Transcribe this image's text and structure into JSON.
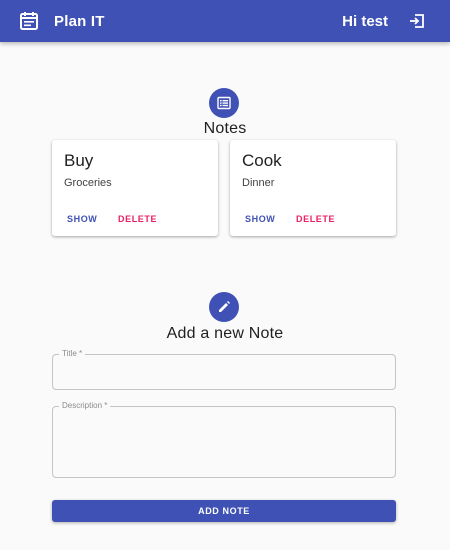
{
  "appbar": {
    "title": "Plan IT",
    "greeting": "Hi test",
    "app_icon": "event-note-icon",
    "logout_icon": "logout-icon"
  },
  "notes_section": {
    "title": "Notes",
    "icon": "list-alt-icon",
    "cards": [
      {
        "title": "Buy",
        "subtitle": "Groceries",
        "show_label": "SHOW",
        "delete_label": "DELETE"
      },
      {
        "title": "Cook",
        "subtitle": "Dinner",
        "show_label": "SHOW",
        "delete_label": "DELETE"
      }
    ]
  },
  "add_section": {
    "title": "Add a new Note",
    "icon": "pencil-icon",
    "title_field": {
      "label": "Title *",
      "value": ""
    },
    "description_field": {
      "label": "Description *",
      "value": ""
    },
    "submit_label": "ADD NOTE"
  },
  "colors": {
    "primary": "#3f51b5",
    "secondary": "#e91e63",
    "background": "#fafafa"
  }
}
